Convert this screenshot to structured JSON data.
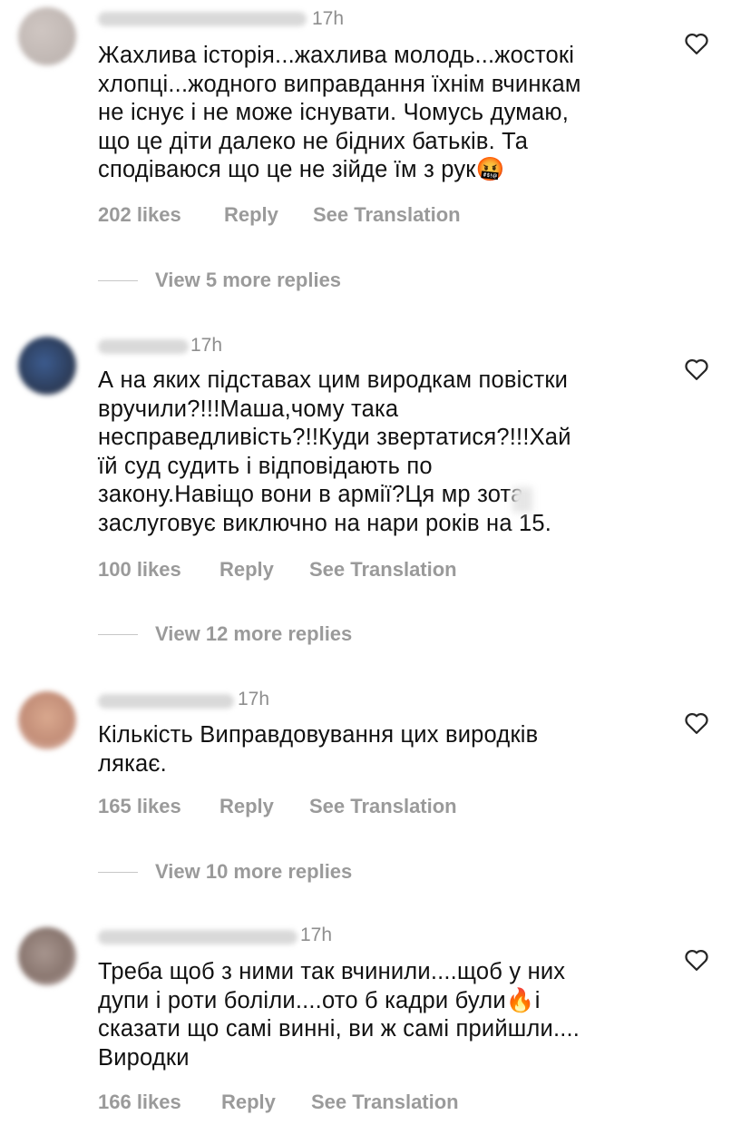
{
  "comments": [
    {
      "time": "17h",
      "text": "Жахлива історія...жахлива молодь...жостокі\nхлопці...жодного виправдання їхнім вчинкам\nне існує і не може існувати. Чомусь думаю,\nщо це діти далеко не бідних батьків. Та\nсподіваюся що це не зійде їм з рук🤬",
      "likes": "202 likes",
      "reply": "Reply",
      "translate": "See Translation",
      "view_replies": "View 5 more replies"
    },
    {
      "time": "17h",
      "text": "А на яких підставах цим виродкам повістки\nвручили?!!!Маша,чому така\nнесправедливість?!!Куди звертатися?!!!Хай\nїй суд судить і відповідають по\nзакону.Навіщо вони в армії?Ця мр  зота\nзаслуговує виключно на нари років на 15.",
      "likes": "100 likes",
      "reply": "Reply",
      "translate": "See Translation",
      "view_replies": "View 12 more replies"
    },
    {
      "time": "17h",
      "text": "Кількість Виправдовування цих виродків\nлякає.",
      "likes": "165 likes",
      "reply": "Reply",
      "translate": "See Translation",
      "view_replies": "View 10 more replies"
    },
    {
      "time": "17h",
      "text": "Треба щоб з ними так вчинили....щоб у них\nдупи і роти боліли....ото б кадри були🔥і\nсказати що самі винні, ви ж самі прийшли....\nВиродки",
      "likes": "166 likes",
      "reply": "Reply",
      "translate": "See Translation"
    }
  ],
  "icons": {
    "like": "heart-outline-icon"
  },
  "colors": {
    "meta_text": "#9a9a9a",
    "time_text": "#8e8e8e",
    "body_text": "#111111"
  }
}
